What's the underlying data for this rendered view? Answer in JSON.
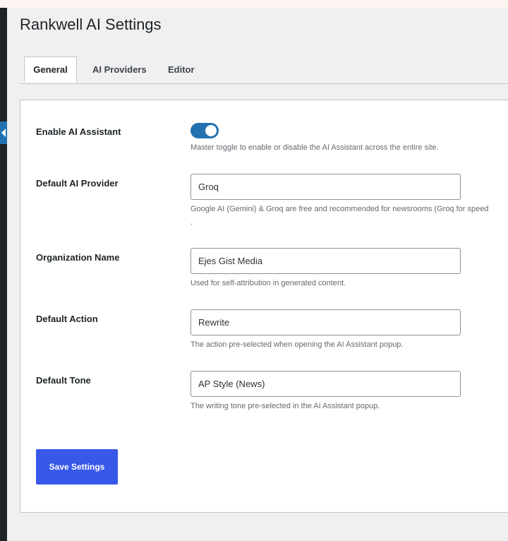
{
  "page": {
    "title": "Rankwell AI Settings"
  },
  "tabs": [
    {
      "label": "General",
      "active": true
    },
    {
      "label": "AI Providers",
      "active": false
    },
    {
      "label": "Editor",
      "active": false
    }
  ],
  "settings": {
    "enable_ai": {
      "label": "Enable AI Assistant",
      "enabled": true,
      "description": "Master toggle to enable or disable the AI Assistant across the entire site."
    },
    "default_provider": {
      "label": "Default AI Provider",
      "value": "Groq",
      "description": "Google AI (Gemini) & Groq are free and recommended for newsrooms (Groq for speed",
      "description_cont": "."
    },
    "organization_name": {
      "label": "Organization Name",
      "value": "Ejes Gist Media",
      "description": "Used for self-attribution in generated content."
    },
    "default_action": {
      "label": "Default Action",
      "value": "Rewrite",
      "description": "The action pre-selected when opening the AI Assistant popup."
    },
    "default_tone": {
      "label": "Default Tone",
      "value": "AP Style (News)",
      "description": "The writing tone pre-selected in the AI Assistant popup."
    }
  },
  "actions": {
    "save_label": "Save Settings"
  },
  "colors": {
    "accent": "#2271b1",
    "button": "#3858e9",
    "sidebar": "#1d2327"
  }
}
